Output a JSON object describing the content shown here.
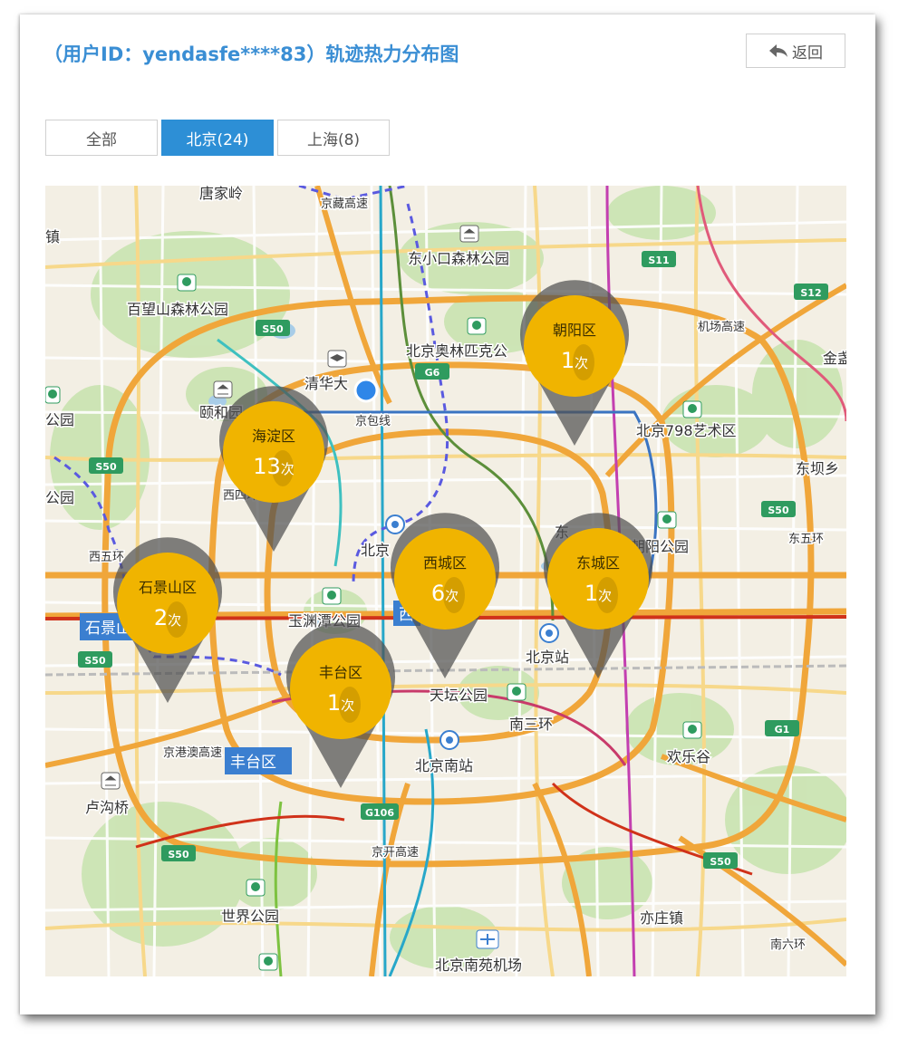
{
  "header": {
    "title": "（用户ID：yendasfe****83）轨迹热力分布图",
    "back_label": "返回"
  },
  "tabs": [
    {
      "label": "全部",
      "active": false
    },
    {
      "label": "北京(24)",
      "active": true
    },
    {
      "label": "上海(8)",
      "active": false
    }
  ],
  "map": {
    "count_unit": "次",
    "pin_color": "#f0b400",
    "district_pins": [
      {
        "name": "朝阳区",
        "count": "1"
      },
      {
        "name": "海淀区",
        "count": "13"
      },
      {
        "name": "西城区",
        "count": "6"
      },
      {
        "name": "东城区",
        "count": "1"
      },
      {
        "name": "石景山区",
        "count": "2"
      },
      {
        "name": "丰台区",
        "count": "1"
      }
    ],
    "place_labels": [
      "唐家岭",
      "东小口森林公园",
      "百望山森林公园",
      "北京奥林匹克公",
      "清华大",
      "颐和园",
      "北京798艺术区",
      "金盏",
      "东坝乡",
      "公园",
      "公园",
      "北京",
      "朝阳公园",
      "玉渊潭公园",
      "北京站",
      "天坛公园",
      "南三环",
      "欢乐谷",
      "北京南站",
      "卢沟桥",
      "世界公园",
      "亦庄镇",
      "北京南苑机场",
      "镇",
      "京包线",
      "西四环北路",
      "西五环",
      "东五环",
      "京开高速",
      "京港澳高速",
      "机场高速",
      "南六环",
      "东",
      "京藏高速"
    ],
    "highway_shields": [
      "S11",
      "S12",
      "S50",
      "S50",
      "S50",
      "S50",
      "S50",
      "S50",
      "G6",
      "G1",
      "G106"
    ],
    "district_tags": [
      "石景山",
      "丰台区",
      "西"
    ]
  }
}
